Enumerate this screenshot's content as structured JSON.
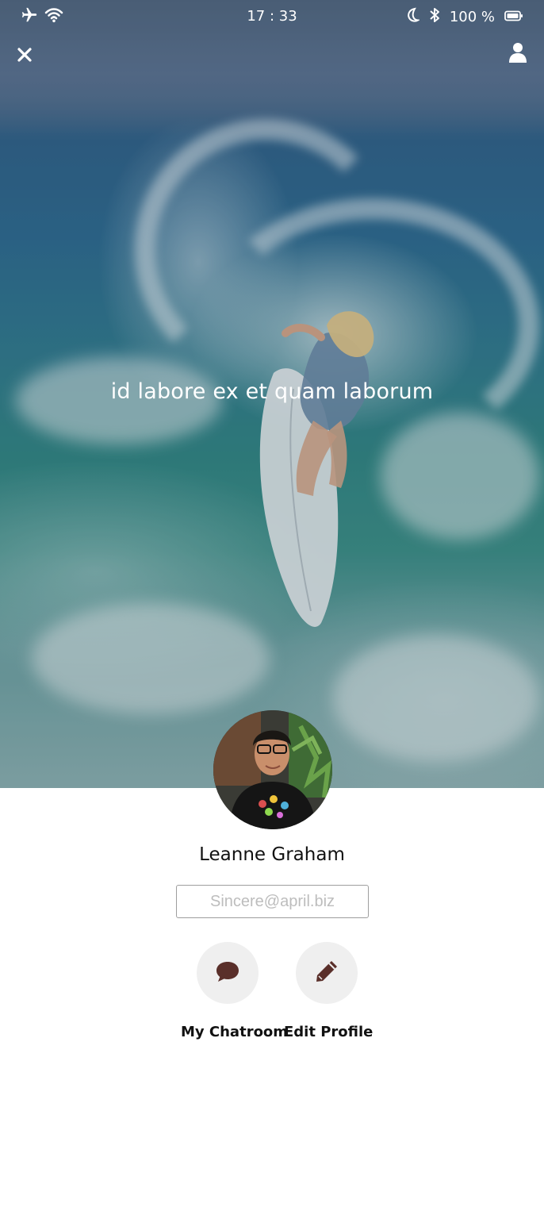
{
  "status_bar": {
    "time": "17 : 33",
    "battery": "100 %",
    "icons": [
      "airplane-icon",
      "wifi-icon",
      "moon-icon",
      "bluetooth-icon",
      "battery-icon"
    ]
  },
  "header": {
    "close_icon": "close-icon",
    "profile_icon": "user-icon"
  },
  "cover": {
    "title": "id labore ex et quam laborum"
  },
  "profile": {
    "name": "Leanne Graham",
    "email_placeholder": "Sincere@april.biz"
  },
  "actions": [
    {
      "label": "My Chatroom",
      "icon": "chat-bubble-icon"
    },
    {
      "label": "Edit Profile",
      "icon": "pencil-icon"
    }
  ],
  "colors": {
    "icon_color": "#5a2f2a",
    "action_bg": "#efefef"
  }
}
